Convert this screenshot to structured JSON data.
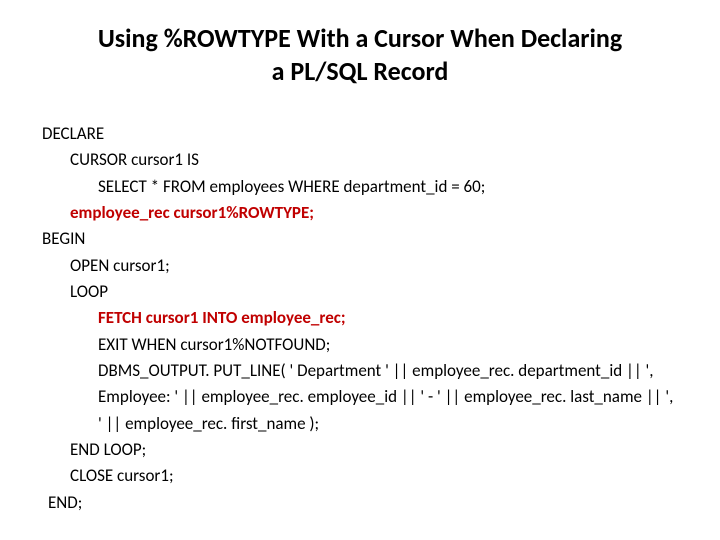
{
  "title": "Using %ROWTYPE With a Cursor When Declaring a PL/SQL Record",
  "code": {
    "l0": "DECLARE",
    "l1": "CURSOR cursor1 IS",
    "l2": "SELECT * FROM employees WHERE department_id = 60;",
    "l3": "employee_rec cursor1%ROWTYPE;",
    "l4": "BEGIN",
    "l5": "OPEN cursor1;",
    "l6": "LOOP",
    "l7": "FETCH cursor1 INTO employee_rec;",
    "l8": "EXIT WHEN cursor1%NOTFOUND;",
    "l9": "DBMS_OUTPUT. PUT_LINE( ' Department ' || employee_rec. department_id || ', Employee: ' || employee_rec. employee_id || ' - ' || employee_rec. last_name || ', ' || employee_rec. first_name );",
    "l10": "END LOOP;",
    "l11": "CLOSE cursor1;",
    "l12": "END;"
  }
}
